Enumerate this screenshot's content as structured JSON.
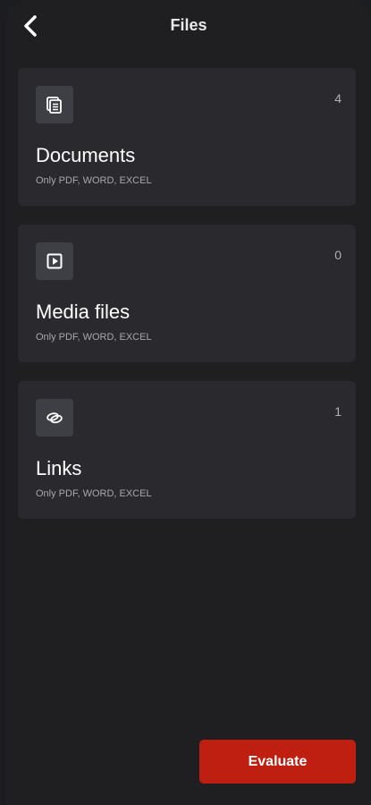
{
  "header": {
    "title": "Files",
    "back_icon": "chevron-left-icon"
  },
  "categories": [
    {
      "title": "Documents",
      "subtitle": "Only PDF, WORD, EXCEL",
      "count": "4",
      "icon": "document-icon"
    },
    {
      "title": "Media files",
      "subtitle": "Only PDF, WORD, EXCEL",
      "count": "0",
      "icon": "media-icon"
    },
    {
      "title": "Links",
      "subtitle": "Only PDF, WORD, EXCEL",
      "count": "1",
      "icon": "link-icon"
    }
  ],
  "footer": {
    "evaluate_label": "Evaluate"
  },
  "colors": {
    "background": "#1f1f22",
    "card": "#2a2a2e",
    "icon_box": "#3e3f44",
    "accent": "#bf1f10"
  }
}
